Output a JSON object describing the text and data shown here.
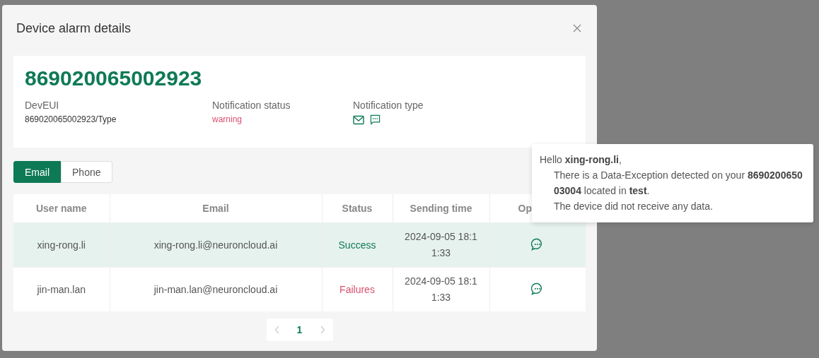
{
  "dialog": {
    "title": "Device alarm details"
  },
  "device": {
    "id": "869020065002923",
    "fields": [
      {
        "label": "DevEUI",
        "value": "869020065002923/Type",
        "kind": "text"
      },
      {
        "label": "Notification status",
        "value": "warning",
        "kind": "warning"
      },
      {
        "label": "Notification type",
        "kind": "icons"
      }
    ]
  },
  "tabs": [
    {
      "label": "Email",
      "selected": true
    },
    {
      "label": "Phone",
      "selected": false
    }
  ],
  "table": {
    "columns": [
      "User name",
      "Email",
      "Status",
      "Sending time",
      "Op"
    ],
    "rows": [
      {
        "user": "xing-rong.li",
        "email": "xing-rong.li@neuroncloud.ai",
        "status": "Success",
        "kind": "success",
        "time": "2024-09-05 18:11:33",
        "selected": true
      },
      {
        "user": "jin-man.lan",
        "email": "jin-man.lan@neuroncloud.ai",
        "status": "Failures",
        "kind": "failure",
        "time": "2024-09-05 18:11:33",
        "selected": false
      }
    ]
  },
  "pagination": {
    "prev_disabled": true,
    "next_disabled": true,
    "pages": [
      {
        "label": "1",
        "selected": true
      }
    ]
  },
  "tooltip": {
    "greeting": "Hello **xing-rong.li**,",
    "lines": [
      "There is a Data-Exception detected on your **869020065003004** located in **test**.",
      "The device did not receive any data."
    ]
  }
}
